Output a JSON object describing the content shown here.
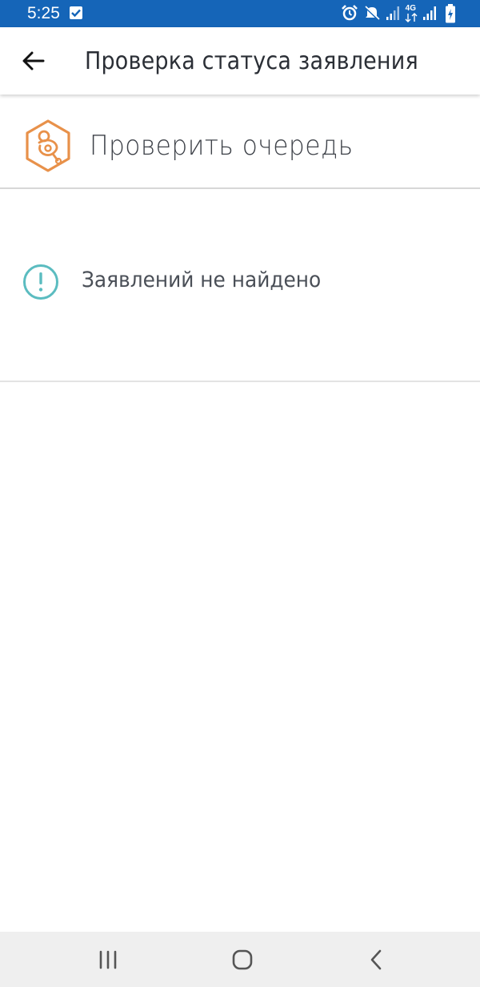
{
  "status_bar": {
    "time": "5:25",
    "network_label": "4G",
    "icons": [
      "checkbox-notification-icon",
      "alarm-icon",
      "mute-icon",
      "signal-icon",
      "signal-icon",
      "battery-charging-icon"
    ],
    "background_color": "#1565b8"
  },
  "app_bar": {
    "title": "Проверка статуса заявления",
    "back_icon": "arrow-left-icon"
  },
  "queue_row": {
    "label": "Проверить очередь",
    "icon": "pacifier-hexagon-icon",
    "icon_color": "#e8914a"
  },
  "empty_state": {
    "message": "Заявлений не найдено",
    "icon": "info-exclamation-icon",
    "icon_color": "#5bbcc0"
  },
  "nav_bar": {
    "icons": [
      "recent-apps-icon",
      "home-icon",
      "back-icon"
    ]
  }
}
